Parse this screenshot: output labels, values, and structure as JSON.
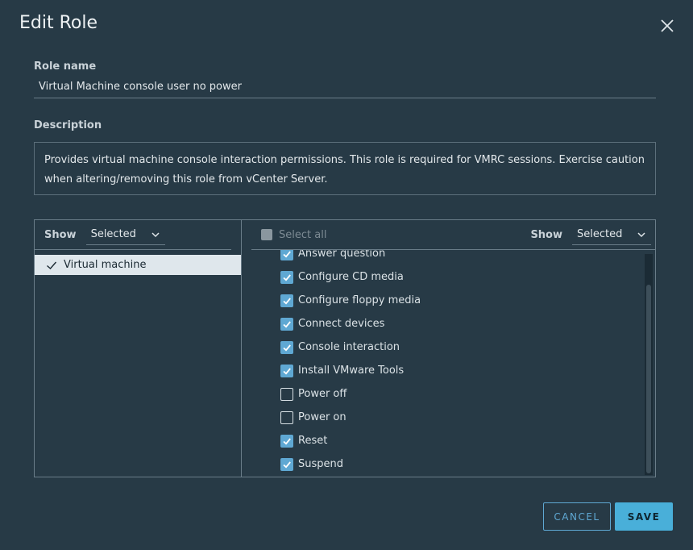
{
  "dialog": {
    "title": "Edit Role",
    "close_icon": "close-icon"
  },
  "role_name": {
    "label": "Role name",
    "value": "Virtual Machine console user no power"
  },
  "description": {
    "label": "Description",
    "text": "Provides virtual machine console interaction permissions. This role is required for VMRC sessions. Exercise caution when altering/removing this role from vCenter Server."
  },
  "privileges": {
    "left": {
      "show_label": "Show",
      "show_value": "Selected",
      "categories": [
        {
          "label": "Virtual machine",
          "selected": true
        }
      ]
    },
    "right": {
      "select_all_label": "Select all",
      "show_label": "Show",
      "show_value": "Selected",
      "items": [
        {
          "label": "Answer question",
          "checked": true
        },
        {
          "label": "Configure CD media",
          "checked": true
        },
        {
          "label": "Configure floppy media",
          "checked": true
        },
        {
          "label": "Connect devices",
          "checked": true
        },
        {
          "label": "Console interaction",
          "checked": true
        },
        {
          "label": "Install VMware Tools",
          "checked": true
        },
        {
          "label": "Power off",
          "checked": false
        },
        {
          "label": "Power on",
          "checked": false
        },
        {
          "label": "Reset",
          "checked": true
        },
        {
          "label": "Suspend",
          "checked": true
        }
      ]
    }
  },
  "footer": {
    "cancel_label": "CANCEL",
    "save_label": "SAVE"
  },
  "colors": {
    "background": "#273a46",
    "accent": "#49afd9",
    "checkbox": "#5fa8d3"
  }
}
